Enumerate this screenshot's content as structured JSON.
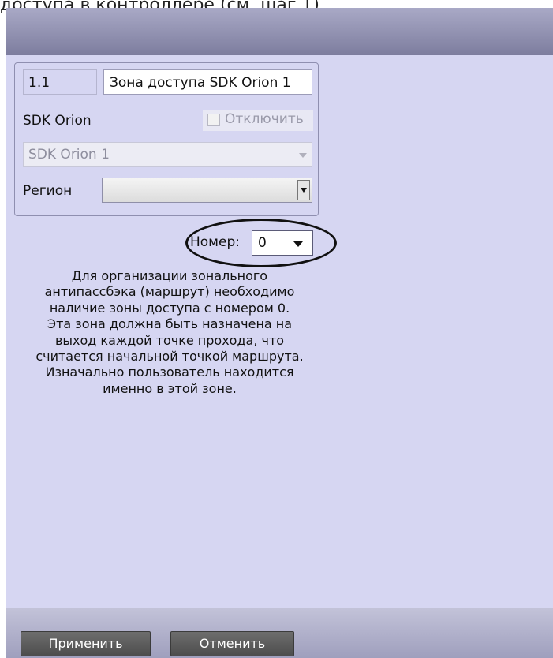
{
  "top_text": "доступа в контроллере (см. шаг 1).",
  "zone": {
    "id": "1.1",
    "name": "Зона доступа SDK Orion 1"
  },
  "device": {
    "label": "SDK Orion",
    "disable_label": "Отключить",
    "disabled": false,
    "selected": "SDK Orion 1"
  },
  "region": {
    "label": "Регион",
    "value": ""
  },
  "number": {
    "label": "Номер:",
    "value": "0"
  },
  "info_lines": [
    "Для организации зонального",
    "антипассбэка (маршрут) необходимо",
    "наличие зоны доступа с номером 0.",
    "Эта зона должна быть назначена на",
    "выход каждой точке прохода, что",
    "считается начальной точкой маршрута.",
    "Изначально пользователь находится",
    "именно в этой зоне."
  ],
  "buttons": {
    "apply": "Применить",
    "cancel": "Отменить"
  },
  "colors": {
    "panel_bg": "#d6d6f2",
    "header_bar": "#8e8eae",
    "button_bg": "#5a5a5a",
    "highlight_ellipse": "#111111"
  }
}
